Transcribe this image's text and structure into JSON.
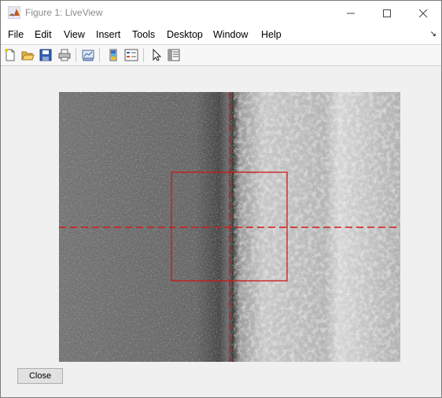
{
  "window": {
    "title": "Figure 1: LiveView"
  },
  "menu": {
    "items": [
      "File",
      "Edit",
      "View",
      "Insert",
      "Tools",
      "Desktop",
      "Window",
      "Help"
    ]
  },
  "toolbar": {
    "icons": [
      "new-figure-icon",
      "open-file-icon",
      "save-icon",
      "print-icon",
      "link-plot-icon",
      "colorbar-icon",
      "legend-icon",
      "pointer-icon",
      "property-inspector-icon"
    ]
  },
  "colors": {
    "crosshair": "#d21a1a",
    "roi_box": "#cc1818",
    "title_text": "#8a8a8a"
  },
  "buttons": {
    "close_label": "Close"
  }
}
